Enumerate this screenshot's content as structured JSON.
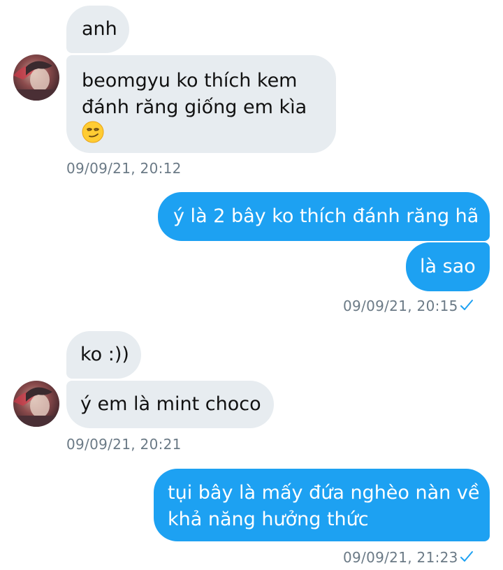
{
  "messages": {
    "m1": "anh",
    "m2_line1": "beomgyu ko thích kem",
    "m2_line2": "đánh răng giống em kìa",
    "m2_emoji": "smirking-face-emoji",
    "ts1": "09/09/21, 20:12",
    "m3": "ý là 2 bây ko thích đánh răng hã",
    "m4": "là sao",
    "ts2": "09/09/21, 20:15",
    "m5": "ko :))",
    "m6": "ý em là mint choco",
    "ts3": "09/09/21, 20:21",
    "m7_line1": "tụi bây là mấy đứa nghèo nàn về",
    "m7_line2": "khả năng hưởng thức",
    "ts4": "09/09/21, 21:23"
  },
  "colors": {
    "incoming_bubble": "#e7ecf0",
    "outgoing_bubble": "#1da1f2",
    "timestamp": "#6b7a86",
    "read_check": "#1da1f2"
  },
  "icons": {
    "read_receipt": "check-icon",
    "avatar": "avatar"
  }
}
